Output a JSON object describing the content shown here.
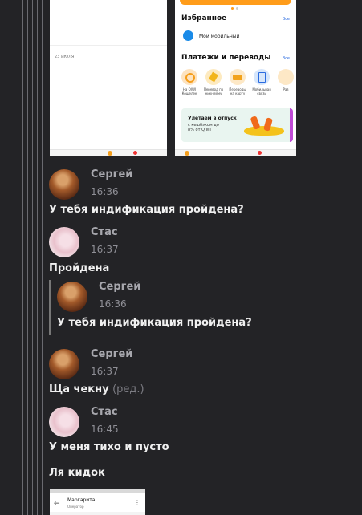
{
  "screenshots": {
    "left": {
      "date_label": "23 ИЮЛЯ"
    },
    "right": {
      "favorites_title": "Избранное",
      "favorites_all": "Все",
      "favorites_item": "Мой мобильный",
      "payments_title": "Платежи и переводы",
      "payments_all": "Все",
      "services": [
        {
          "label": "На QIWI Кошелек"
        },
        {
          "label": "Перевод по никнейму"
        },
        {
          "label": "Переводы на карту"
        },
        {
          "label": "Мобильная связь"
        },
        {
          "label": "Раз"
        }
      ],
      "banner_title": "Улетаем в отпуск",
      "banner_sub": "с кешбэком до 8% от QIWI"
    },
    "bottom": {
      "contact_name": "Маргарита",
      "contact_role": "Оператор"
    }
  },
  "messages": [
    {
      "author": "Сергей",
      "time": "16:36",
      "text": "У тебя индификация пройдена?"
    },
    {
      "author": "Стас",
      "time": "16:37",
      "text": "Пройдена"
    },
    {
      "author": "Сергей",
      "time": "16:37",
      "text": "Ща чекну",
      "edited": "(ред.)"
    },
    {
      "author": "Стас",
      "time": "16:45",
      "text": "У меня тихо и пусто"
    },
    {
      "text": "Ля кидок"
    }
  ],
  "quote": {
    "author": "Сергей",
    "time": "16:36",
    "text": "У тебя индификация пройдена?"
  }
}
